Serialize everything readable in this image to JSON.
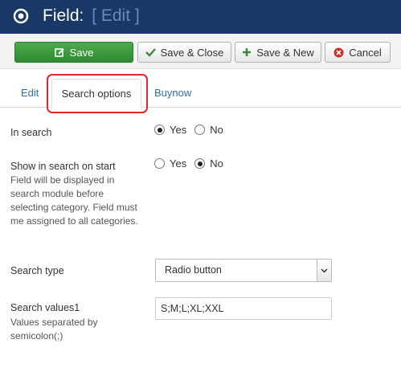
{
  "header": {
    "title": "Field:",
    "subtitle": "[ Edit ]"
  },
  "toolbar": {
    "save_label": "Save",
    "save_close_label": "Save & Close",
    "save_new_label": "Save & New",
    "cancel_label": "Cancel"
  },
  "tabs": [
    {
      "label": "Edit",
      "active": false
    },
    {
      "label": "Search options",
      "active": true
    },
    {
      "label": "Buynow",
      "active": false
    }
  ],
  "fields": {
    "in_search": {
      "label": "In search",
      "options": [
        "Yes",
        "No"
      ],
      "selected": "Yes"
    },
    "show_on_start": {
      "label": "Show in search on start",
      "description": "Field will be displayed in search module before selecting category. Field must me assigned to all categories.",
      "options": [
        "Yes",
        "No"
      ],
      "selected": "No"
    },
    "search_type": {
      "label": "Search type",
      "value": "Radio button"
    },
    "search_values": {
      "label": "Search values1",
      "description": "Values separated by semicolon(;)",
      "value": "S;M;L;XL;XXL"
    }
  },
  "colors": {
    "header_bg": "#1a3867",
    "save_green": "#3c9a3c",
    "link_blue": "#2f6fa6",
    "highlight_red": "#e8262a"
  },
  "icons": {
    "logo": "joomla-ring-icon",
    "save": "edit-icon",
    "save_close": "check-icon",
    "save_new": "plus-icon",
    "cancel": "cancel-circle-icon",
    "select_arrow": "chevron-down-icon"
  }
}
